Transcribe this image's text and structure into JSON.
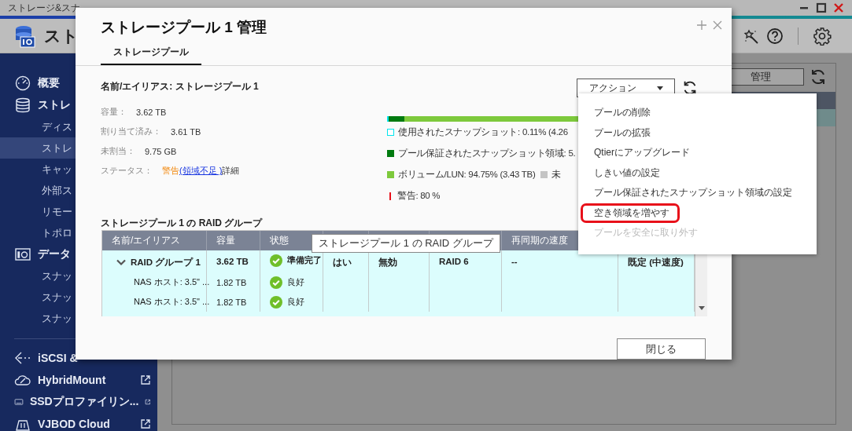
{
  "app": {
    "title": "ストレージ&スナ",
    "header_title": "スト",
    "manage_button": "管理"
  },
  "sidebar": {
    "sections": [
      {
        "items": [
          {
            "label": "概要",
            "selected": false
          },
          {
            "label": "ストレ",
            "selected": false,
            "children": [
              {
                "label": "ディス",
                "selected": false
              },
              {
                "label": "ストレ",
                "selected": true
              },
              {
                "label": "キャッ",
                "selected": false
              },
              {
                "label": "外部ス",
                "selected": false
              },
              {
                "label": "リモー",
                "selected": false
              },
              {
                "label": "トポロ",
                "selected": false
              }
            ]
          },
          {
            "label": "データ",
            "selected": false,
            "children": [
              {
                "label": "スナッ",
                "selected": false
              },
              {
                "label": "スナッ",
                "selected": false
              },
              {
                "label": "スナッ",
                "selected": false
              }
            ]
          }
        ]
      },
      {
        "items": [
          {
            "label": "iSCSI &",
            "selected": false,
            "external": false
          },
          {
            "label": "HybridMount",
            "selected": false,
            "external": true
          },
          {
            "label": "SSDプロファイリン...",
            "selected": false,
            "external": true
          },
          {
            "label": "VJBOD Cloud",
            "selected": false,
            "external": true
          }
        ]
      }
    ]
  },
  "dialog": {
    "title": "ストレージプール 1 管理",
    "tabs": [
      {
        "label": "ストレージプール",
        "selected": true
      }
    ],
    "name_line": "名前/エイリアス: ストレージプール 1",
    "info": [
      {
        "label": "容量：",
        "value": "3.62 TB"
      },
      {
        "label": "割り当て済み：",
        "value": "3.61 TB"
      },
      {
        "label": "未割当：",
        "value": "9.75 GB"
      }
    ],
    "status": {
      "label": "ステータス：",
      "value": "警告",
      "link": "(領域不足 )",
      "detail": "詳細"
    },
    "action_button": "アクション",
    "usage_bar": {
      "segments": [
        {
          "color": "#00e5ee",
          "level": 0.0011
        },
        {
          "color": "#007a0f",
          "level": 0.05
        },
        {
          "color": "#7dc93c",
          "level": 0.9475
        }
      ]
    },
    "legend": [
      {
        "kind": "outline",
        "color": "#00e5ee",
        "label": "使用されたスナップショット: 0.11% (4.26"
      },
      {
        "kind": "fill",
        "color": "#007a0f",
        "label": "プール保証されたスナップショット領域: 5."
      },
      {
        "kind": "fill",
        "color": "#7dc93c",
        "label": "ボリューム/LUN: 94.75% (3.43 TB)",
        "extra_label": "未"
      },
      {
        "kind": "mark",
        "color": "#e8101a",
        "label": "警告: 80 %"
      }
    ],
    "raid_title": "ストレージプール 1 の RAID グループ",
    "table": {
      "columns": [
        "名前/エイリアス",
        "容量",
        "状態",
        null,
        null,
        null,
        "再同期の速度",
        null
      ],
      "rows": [
        {
          "kind": "group",
          "expanded": true,
          "cells": [
            "RAID グループ 1",
            "3.62 TB",
            "準備完了",
            "はい",
            "無効",
            "RAID 6",
            "--",
            "既定 (中速度)"
          ]
        },
        {
          "kind": "disk",
          "cells": [
            "NAS ホスト: 3.5\" ...",
            "1.82 TB",
            "良好",
            null,
            null,
            null,
            null,
            null
          ]
        },
        {
          "kind": "disk",
          "cells": [
            "NAS ホスト: 3.5\" ...",
            "1.82 TB",
            "良好",
            null,
            null,
            null,
            null,
            null
          ]
        }
      ]
    },
    "tooltip": "ストレージプール 1 の RAID グループ",
    "close_button": "閉じる"
  },
  "menu": {
    "items": [
      {
        "label": "プールの削除",
        "disabled": false,
        "annotated": false
      },
      {
        "label": "プールの拡張",
        "disabled": false,
        "annotated": false
      },
      {
        "label": "Qtierにアップグレード",
        "disabled": false,
        "annotated": false
      },
      {
        "label": "しきい値の設定",
        "disabled": false,
        "annotated": false
      },
      {
        "label": "プール保証されたスナップショット領域の設定",
        "disabled": false,
        "annotated": false
      },
      {
        "label": "空き領域を増やす",
        "disabled": false,
        "annotated": true
      },
      {
        "label": "プールを安全に取り外す",
        "disabled": true,
        "annotated": false
      }
    ]
  }
}
